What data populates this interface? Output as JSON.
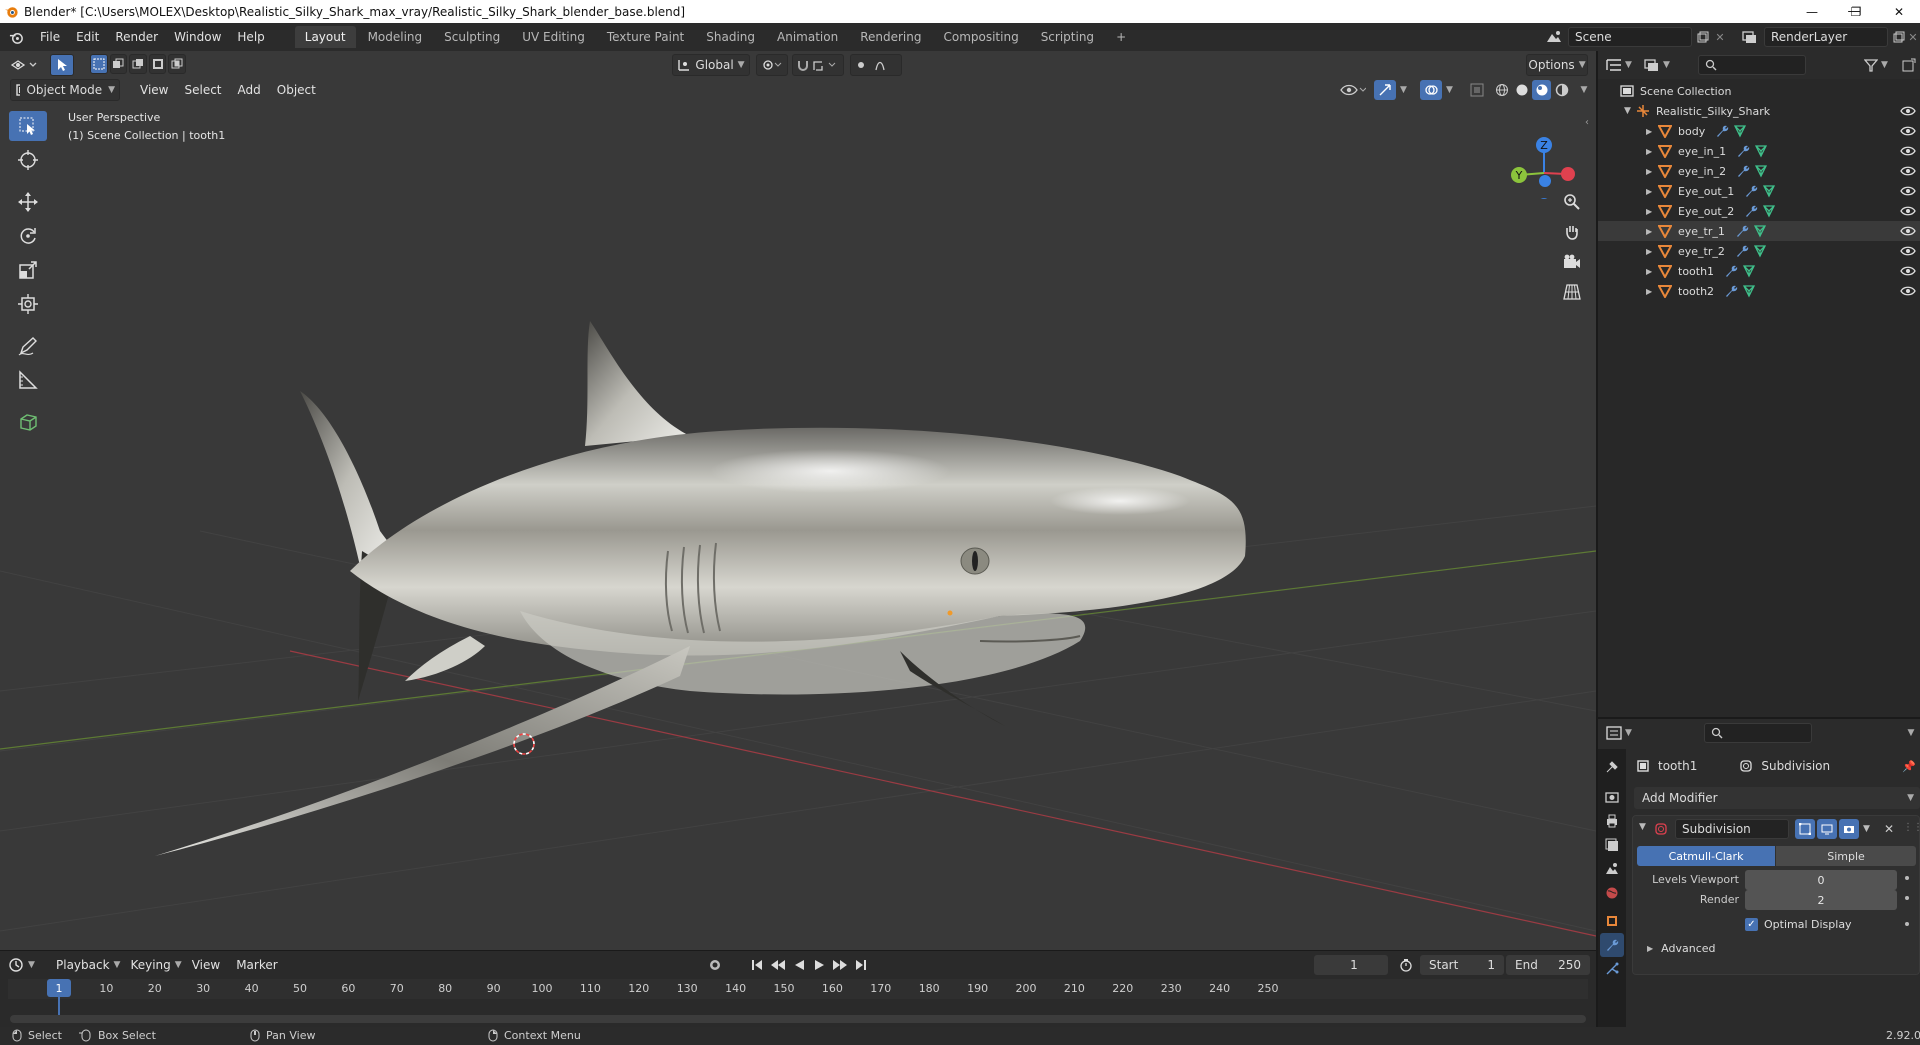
{
  "titlebar": {
    "title": "Blender* [C:\\Users\\MOLEX\\Desktop\\Realistic_Silky_Shark_max_vray/Realistic_Silky_Shark_blender_base.blend]",
    "minimize": "—",
    "maximize": "❐",
    "close": "✕"
  },
  "menu": [
    "File",
    "Edit",
    "Render",
    "Window",
    "Help"
  ],
  "workspaces": [
    "Layout",
    "Modeling",
    "Sculpting",
    "UV Editing",
    "Texture Paint",
    "Shading",
    "Animation",
    "Rendering",
    "Compositing",
    "Scripting"
  ],
  "workspace_add": "+",
  "scene": {
    "name": "Scene",
    "view_layer": "RenderLayer"
  },
  "viewport": {
    "mode": "Object Mode",
    "menus": [
      "View",
      "Select",
      "Add",
      "Object"
    ],
    "transform_orientation": "Global",
    "options_label": "Options",
    "overlay_line1": "User Perspective",
    "overlay_line2": "(1) Scene Collection | tooth1",
    "gizmo_z": "Z",
    "gizmo_y": "Y"
  },
  "outliner": {
    "root": "Scene Collection",
    "collection": "Realistic_Silky_Shark",
    "objects": [
      {
        "name": "body",
        "selected": false
      },
      {
        "name": "eye_in_1",
        "selected": false
      },
      {
        "name": "eye_in_2",
        "selected": false
      },
      {
        "name": "Eye_out_1",
        "selected": false
      },
      {
        "name": "Eye_out_2",
        "selected": false
      },
      {
        "name": "eye_tr_1",
        "selected": true
      },
      {
        "name": "eye_tr_2",
        "selected": false
      },
      {
        "name": "tooth1",
        "selected": false
      },
      {
        "name": "tooth2",
        "selected": false
      }
    ]
  },
  "properties": {
    "object_name": "tooth1",
    "modifier_breadcrumb": "Subdivision",
    "add_modifier": "Add Modifier",
    "modifier": {
      "name": "Subdivision",
      "type_catmull": "Catmull-Clark",
      "type_simple": "Simple",
      "levels_viewport_label": "Levels Viewport",
      "levels_viewport": "0",
      "render_label": "Render",
      "render": "2",
      "optimal_display_label": "Optimal Display",
      "optimal_display": true,
      "advanced_label": "Advanced"
    }
  },
  "timeline": {
    "menus": [
      "Playback",
      "Keying",
      "View",
      "Marker"
    ],
    "current_frame": "1",
    "start_label": "Start",
    "start": "1",
    "end_label": "End",
    "end": "250",
    "ruler": [
      "1",
      "10",
      "20",
      "30",
      "40",
      "50",
      "60",
      "70",
      "80",
      "90",
      "100",
      "110",
      "120",
      "130",
      "140",
      "150",
      "160",
      "170",
      "180",
      "190",
      "200",
      "210",
      "220",
      "230",
      "240",
      "250"
    ]
  },
  "statusbar": {
    "select": "Select",
    "box_select": "Box Select",
    "pan_view": "Pan View",
    "context_menu": "Context Menu",
    "version": "2.92.0"
  },
  "colors": {
    "accent": "#4772b3",
    "viewport_bg": "#393939",
    "mesh_icon": "#e8873a",
    "modifier_icon": "#6a9ad6",
    "vertex_group_icon": "#3fbf8a",
    "axis_x": "#e0414f",
    "axis_y": "#8cc43c",
    "axis_z": "#3a82e4"
  }
}
